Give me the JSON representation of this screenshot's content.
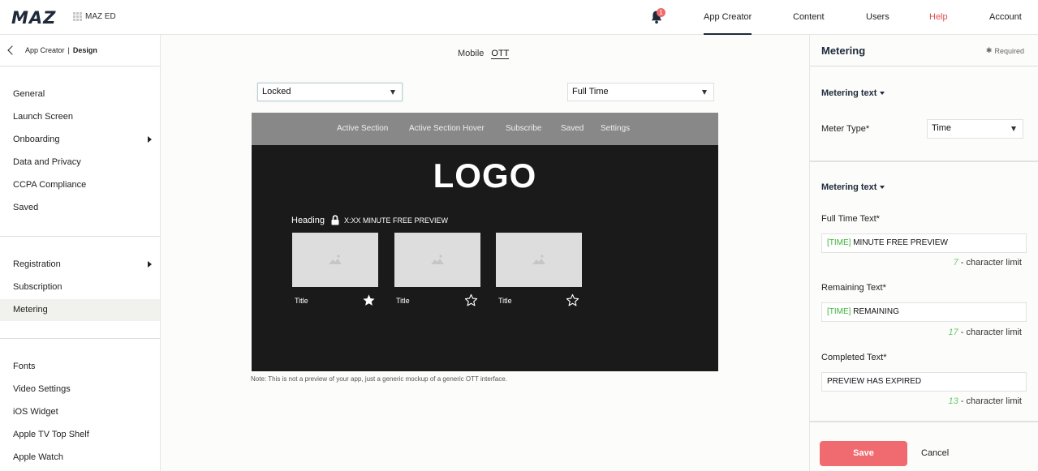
{
  "header": {
    "logo": "MAZ",
    "org_name": "MAZ ED",
    "notification_count": "1",
    "nav": [
      "App Creator",
      "Content",
      "Users",
      "Help",
      "Account"
    ],
    "active_nav": "App Creator"
  },
  "breadcrumb": {
    "parent": "App Creator",
    "separator": "|",
    "current": "Design"
  },
  "sidebar": {
    "groups": [
      [
        "General",
        "Launch Screen",
        "Onboarding",
        "Data and Privacy",
        "CCPA Compliance",
        "Saved"
      ],
      [
        "Registration",
        "Subscription",
        "Metering"
      ],
      [
        "Fonts",
        "Video Settings",
        "iOS Widget",
        "Apple TV Top Shelf",
        "Apple Watch"
      ]
    ],
    "active": "Metering"
  },
  "main": {
    "platform_tabs": [
      "Mobile",
      "OTT"
    ],
    "active_platform": "OTT",
    "state_select": "Locked",
    "type_select": "Full Time",
    "mockup": {
      "nav_items": [
        "Active Section",
        "Active Section Hover",
        "Subscribe",
        "Saved",
        "Settings"
      ],
      "logo": "LOGO",
      "heading": "Heading",
      "preview_text": "X:XX MINUTE FREE PREVIEW",
      "cards": [
        {
          "title": "Title",
          "star": "filled"
        },
        {
          "title": "Title",
          "star": "outline"
        },
        {
          "title": "Title",
          "star": "outline"
        }
      ]
    },
    "note": "Note: This is not a preview of your app, just a generic mockup of a generic OTT interface."
  },
  "panel": {
    "title": "Metering",
    "required_label": "Required",
    "section1_title": "Metering text",
    "meter_type_label": "Meter Type*",
    "meter_type_value": "Time",
    "section2_title": "Metering text",
    "fields": [
      {
        "label": "Full Time Text*",
        "token": "[TIME]",
        "text": " MINUTE FREE PREVIEW",
        "limit_count": "7",
        "limit_text": " - character limit"
      },
      {
        "label": "Remaining Text*",
        "token": "[TIME]",
        "text": " REMAINING",
        "limit_count": "17",
        "limit_text": " - character limit"
      },
      {
        "label": "Completed Text*",
        "token": "",
        "text": "PREVIEW HAS EXPIRED",
        "limit_count": "13",
        "limit_text": " - character limit"
      }
    ],
    "save_label": "Save",
    "cancel_label": "Cancel"
  },
  "colors": {
    "accent": "#f06b6f",
    "token_green": "#3db33d",
    "help_red": "#e05050",
    "navy": "#1e2a3a"
  },
  "icons": [
    "bell-icon",
    "grid-icon",
    "back-chevron-icon",
    "lock-icon",
    "image-placeholder-icon",
    "star-filled-icon",
    "star-outline-icon",
    "asterisk-icon",
    "caret-down-icon",
    "chevron-right-icon"
  ]
}
